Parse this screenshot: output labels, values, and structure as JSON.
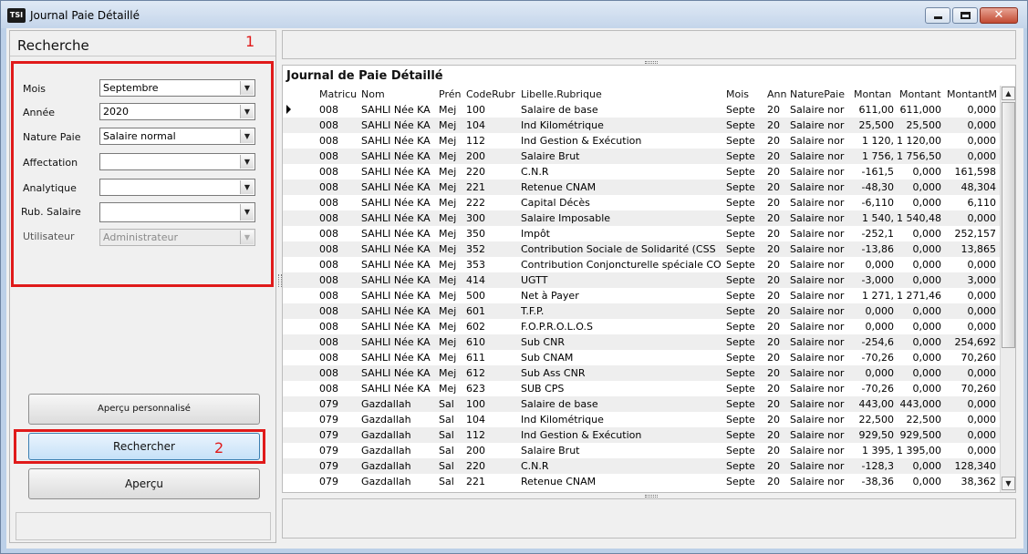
{
  "window": {
    "title": "Journal Paie Détaillé",
    "app_icon_text": "TSI",
    "minimize_glyph": "",
    "maximize_glyph": "",
    "close_glyph": "✕"
  },
  "left_panel": {
    "title": "Recherche",
    "annotation_1": "1",
    "annotation_2": "2",
    "fields": [
      {
        "label": "Mois",
        "value": "Septembre",
        "disabled": false
      },
      {
        "label": "Année",
        "value": "2020",
        "disabled": false
      },
      {
        "label": "Nature Paie",
        "value": "Salaire normal",
        "disabled": false
      },
      {
        "label": "Affectation",
        "value": "",
        "disabled": false
      },
      {
        "label": "Analytique",
        "value": "",
        "disabled": false
      },
      {
        "label": "Rub. Salaire",
        "value": "",
        "disabled": false
      },
      {
        "label": "Utilisateur",
        "value": "Administrateur",
        "disabled": true
      }
    ],
    "dropdown_glyph": "▼",
    "buttons": {
      "apercu_personnalise": "Aperçu personnalisé",
      "rechercher": "Rechercher",
      "apercu": "Aperçu"
    }
  },
  "grid": {
    "title": "Journal de Paie Détaillé",
    "columns": [
      "Matricu",
      "Nom",
      "Prén",
      "CodeRubr",
      "Libelle.Rubrique",
      "Mois",
      "Ann",
      "NaturePaie",
      "Montan",
      "Montant",
      "MontantM"
    ],
    "scroll_up": "▲",
    "scroll_down": "▼",
    "rows": [
      [
        "008",
        "SAHLI Née KA",
        "Mej",
        "100",
        "Salaire de base",
        "Septe",
        "20",
        "Salaire nor",
        "611,00",
        "611,000",
        "0,000"
      ],
      [
        "008",
        "SAHLI Née KA",
        "Mej",
        "104",
        "Ind Kilométrique",
        "Septe",
        "20",
        "Salaire nor",
        "25,500",
        "25,500",
        "0,000"
      ],
      [
        "008",
        "SAHLI Née KA",
        "Mej",
        "112",
        "Ind Gestion & Exécution",
        "Septe",
        "20",
        "Salaire nor",
        "1 120,",
        "1 120,00",
        "0,000"
      ],
      [
        "008",
        "SAHLI Née KA",
        "Mej",
        "200",
        "Salaire Brut",
        "Septe",
        "20",
        "Salaire nor",
        "1 756,",
        "1 756,50",
        "0,000"
      ],
      [
        "008",
        "SAHLI Née KA",
        "Mej",
        "220",
        "C.N.R",
        "Septe",
        "20",
        "Salaire nor",
        "-161,5",
        "0,000",
        "161,598"
      ],
      [
        "008",
        "SAHLI Née KA",
        "Mej",
        "221",
        "Retenue CNAM",
        "Septe",
        "20",
        "Salaire nor",
        "-48,30",
        "0,000",
        "48,304"
      ],
      [
        "008",
        "SAHLI Née KA",
        "Mej",
        "222",
        "Capital Décès",
        "Septe",
        "20",
        "Salaire nor",
        "-6,110",
        "0,000",
        "6,110"
      ],
      [
        "008",
        "SAHLI Née KA",
        "Mej",
        "300",
        "Salaire Imposable",
        "Septe",
        "20",
        "Salaire nor",
        "1 540,",
        "1 540,48",
        "0,000"
      ],
      [
        "008",
        "SAHLI Née KA",
        "Mej",
        "350",
        "Impôt",
        "Septe",
        "20",
        "Salaire nor",
        "-252,1",
        "0,000",
        "252,157"
      ],
      [
        "008",
        "SAHLI Née KA",
        "Mej",
        "352",
        "Contribution Sociale de Solidarité (CSS",
        "Septe",
        "20",
        "Salaire nor",
        "-13,86",
        "0,000",
        "13,865"
      ],
      [
        "008",
        "SAHLI Née KA",
        "Mej",
        "353",
        "Contribution Conjoncturelle spéciale CO",
        "Septe",
        "20",
        "Salaire nor",
        "0,000",
        "0,000",
        "0,000"
      ],
      [
        "008",
        "SAHLI Née KA",
        "Mej",
        "414",
        "UGTT",
        "Septe",
        "20",
        "Salaire nor",
        "-3,000",
        "0,000",
        "3,000"
      ],
      [
        "008",
        "SAHLI Née KA",
        "Mej",
        "500",
        "Net à Payer",
        "Septe",
        "20",
        "Salaire nor",
        "1 271,",
        "1 271,46",
        "0,000"
      ],
      [
        "008",
        "SAHLI Née KA",
        "Mej",
        "601",
        "T.F.P.",
        "Septe",
        "20",
        "Salaire nor",
        "0,000",
        "0,000",
        "0,000"
      ],
      [
        "008",
        "SAHLI Née KA",
        "Mej",
        "602",
        "F.O.P.R.O.L.O.S",
        "Septe",
        "20",
        "Salaire nor",
        "0,000",
        "0,000",
        "0,000"
      ],
      [
        "008",
        "SAHLI Née KA",
        "Mej",
        "610",
        "Sub CNR",
        "Septe",
        "20",
        "Salaire nor",
        "-254,6",
        "0,000",
        "254,692"
      ],
      [
        "008",
        "SAHLI Née KA",
        "Mej",
        "611",
        "Sub CNAM",
        "Septe",
        "20",
        "Salaire nor",
        "-70,26",
        "0,000",
        "70,260"
      ],
      [
        "008",
        "SAHLI Née KA",
        "Mej",
        "612",
        "Sub Ass CNR",
        "Septe",
        "20",
        "Salaire nor",
        "0,000",
        "0,000",
        "0,000"
      ],
      [
        "008",
        "SAHLI Née KA",
        "Mej",
        "623",
        "SUB CPS",
        "Septe",
        "20",
        "Salaire nor",
        "-70,26",
        "0,000",
        "70,260"
      ],
      [
        "079",
        "Gazdallah",
        "Sal",
        "100",
        "Salaire de base",
        "Septe",
        "20",
        "Salaire nor",
        "443,00",
        "443,000",
        "0,000"
      ],
      [
        "079",
        "Gazdallah",
        "Sal",
        "104",
        "Ind Kilométrique",
        "Septe",
        "20",
        "Salaire nor",
        "22,500",
        "22,500",
        "0,000"
      ],
      [
        "079",
        "Gazdallah",
        "Sal",
        "112",
        "Ind Gestion & Exécution",
        "Septe",
        "20",
        "Salaire nor",
        "929,50",
        "929,500",
        "0,000"
      ],
      [
        "079",
        "Gazdallah",
        "Sal",
        "200",
        "Salaire Brut",
        "Septe",
        "20",
        "Salaire nor",
        "1 395,",
        "1 395,00",
        "0,000"
      ],
      [
        "079",
        "Gazdallah",
        "Sal",
        "220",
        "C.N.R",
        "Septe",
        "20",
        "Salaire nor",
        "-128,3",
        "0,000",
        "128,340"
      ],
      [
        "079",
        "Gazdallah",
        "Sal",
        "221",
        "Retenue CNAM",
        "Septe",
        "20",
        "Salaire nor",
        "-38,36",
        "0,000",
        "38,362"
      ]
    ]
  }
}
